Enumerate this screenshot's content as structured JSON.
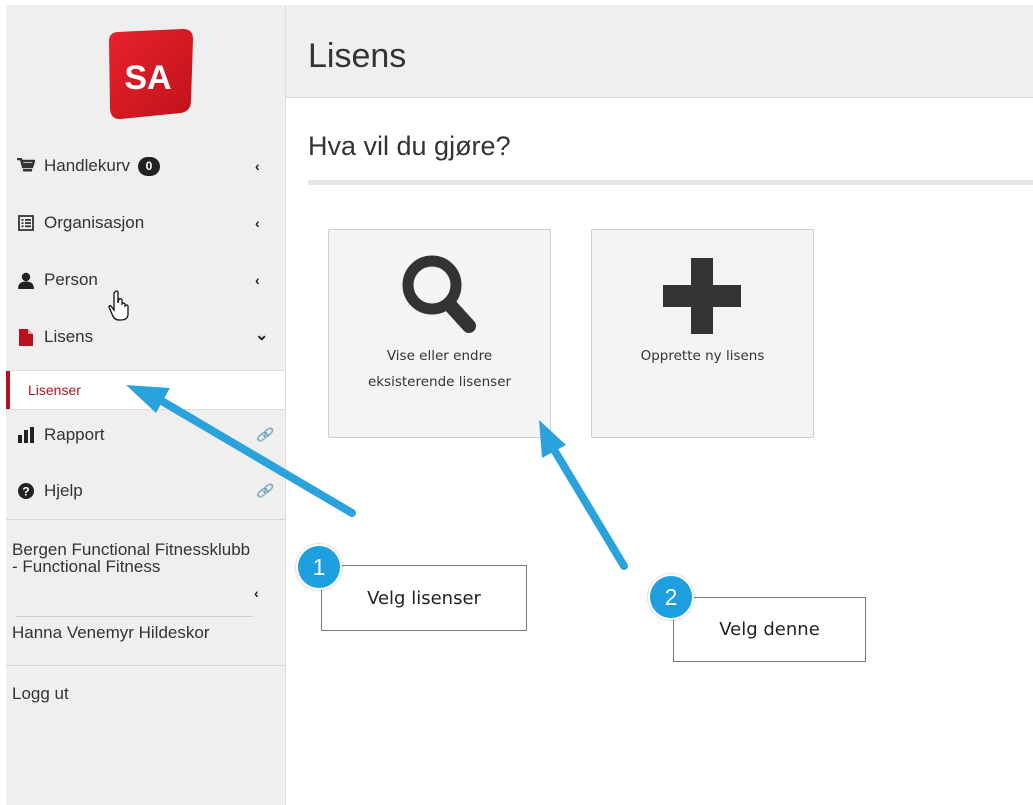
{
  "logo": {
    "text": "SA"
  },
  "sidebar": {
    "items": [
      {
        "label": "Handlekurv",
        "badge": "0",
        "chevron": "‹",
        "icon": "cart-icon"
      },
      {
        "label": "Organisasjon",
        "chevron": "‹",
        "icon": "list-icon"
      },
      {
        "label": "Person",
        "chevron": "‹",
        "icon": "user-icon"
      },
      {
        "label": "Lisens",
        "chevron": "⌄",
        "icon": "document-icon"
      },
      {
        "label": "Rapport",
        "link": "🔗",
        "icon": "bar-chart-icon"
      },
      {
        "label": "Hjelp",
        "link": "🔗",
        "icon": "question-icon"
      }
    ],
    "subitem": {
      "label": "Lisenser"
    },
    "org_name": "Bergen Functional Fitnessklubb - Functional Fitness",
    "org_chevron": "‹",
    "user_name": "Hanna Venemyr Hildeskor",
    "logout": "Logg ut"
  },
  "header": {
    "title": "Lisens"
  },
  "main": {
    "subtitle": "Hva vil du gjøre?",
    "tiles": [
      {
        "label_line1": "Vise eller endre",
        "label_line2": "eksisterende lisenser",
        "icon": "search-icon"
      },
      {
        "label_line1": "Opprette ny lisens",
        "icon": "plus-icon"
      }
    ]
  },
  "callouts": [
    {
      "number": "1",
      "text": "Velg lisenser"
    },
    {
      "number": "2",
      "text": "Velg denne"
    }
  ],
  "colors": {
    "brand_red": "#b8111b",
    "callout_blue": "#1e9fe0"
  }
}
